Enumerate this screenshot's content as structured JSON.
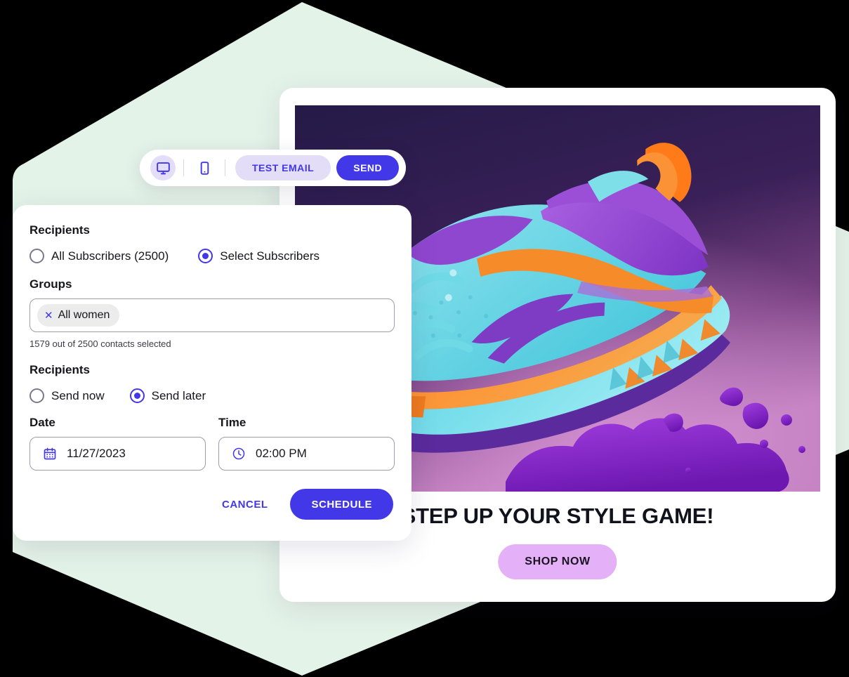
{
  "theme": {
    "accent": "#4338E8",
    "accent_soft": "#E3DDF8",
    "hex_background": "#E4F3E8",
    "chip_background": "#ECECED",
    "shop_button": "#E4B0F7",
    "hero_dark": "#2A2050"
  },
  "toolbar": {
    "desktop_icon": "monitor-icon",
    "mobile_icon": "phone-icon",
    "test_email_label": "TEST EMAIL",
    "send_label": "SEND"
  },
  "form": {
    "recipients_label": "Recipients",
    "audience_options": [
      {
        "label": "All Subscribers (2500)",
        "selected": false
      },
      {
        "label": "Select Subscribers",
        "selected": true
      }
    ],
    "groups_label": "Groups",
    "group_chips": [
      {
        "label": "All women",
        "remove_icon": "close-icon"
      }
    ],
    "contacts_help": "1579 out of 2500 contacts selected",
    "schedule_label": "Recipients",
    "timing_options": [
      {
        "label": "Send now",
        "selected": false
      },
      {
        "label": "Send later",
        "selected": true
      }
    ],
    "date": {
      "caption": "Date",
      "icon": "calendar-icon",
      "value": "11/27/2023"
    },
    "time": {
      "caption": "Time",
      "icon": "clock-icon",
      "value": "02:00 PM"
    },
    "cancel_label": "CANCEL",
    "schedule_button_label": "SCHEDULE"
  },
  "preview": {
    "hero_alt": "sneaker-product-photo",
    "headline": "STEP UP YOUR STYLE GAME!",
    "cta_label": "SHOP NOW"
  }
}
